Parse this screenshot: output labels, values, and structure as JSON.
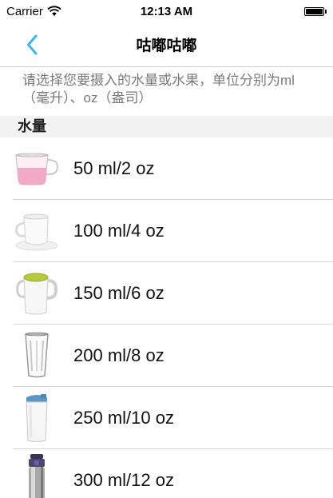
{
  "status_bar": {
    "carrier": "Carrier",
    "time": "12:13 AM",
    "battery_level": 1.0
  },
  "nav": {
    "title": "咕嘟咕嘟",
    "back_icon": "chevron-left-icon",
    "accent_color": "#3fb5e8"
  },
  "instructions": "请选择您要摄入的水量或水果，单位分别为ml（毫升）、oz（盎司）",
  "section": {
    "title": "水量"
  },
  "items": [
    {
      "label": "50 ml/2 oz",
      "icon": "pink-tea-cup-icon"
    },
    {
      "label": "100 ml/4 oz",
      "icon": "white-mug-icon"
    },
    {
      "label": "150 ml/6 oz",
      "icon": "tea-mug-icon"
    },
    {
      "label": "200 ml/8 oz",
      "icon": "glass-icon"
    },
    {
      "label": "250 ml/10 oz",
      "icon": "tumbler-icon"
    },
    {
      "label": "300 ml/12 oz",
      "icon": "thermos-icon"
    }
  ]
}
